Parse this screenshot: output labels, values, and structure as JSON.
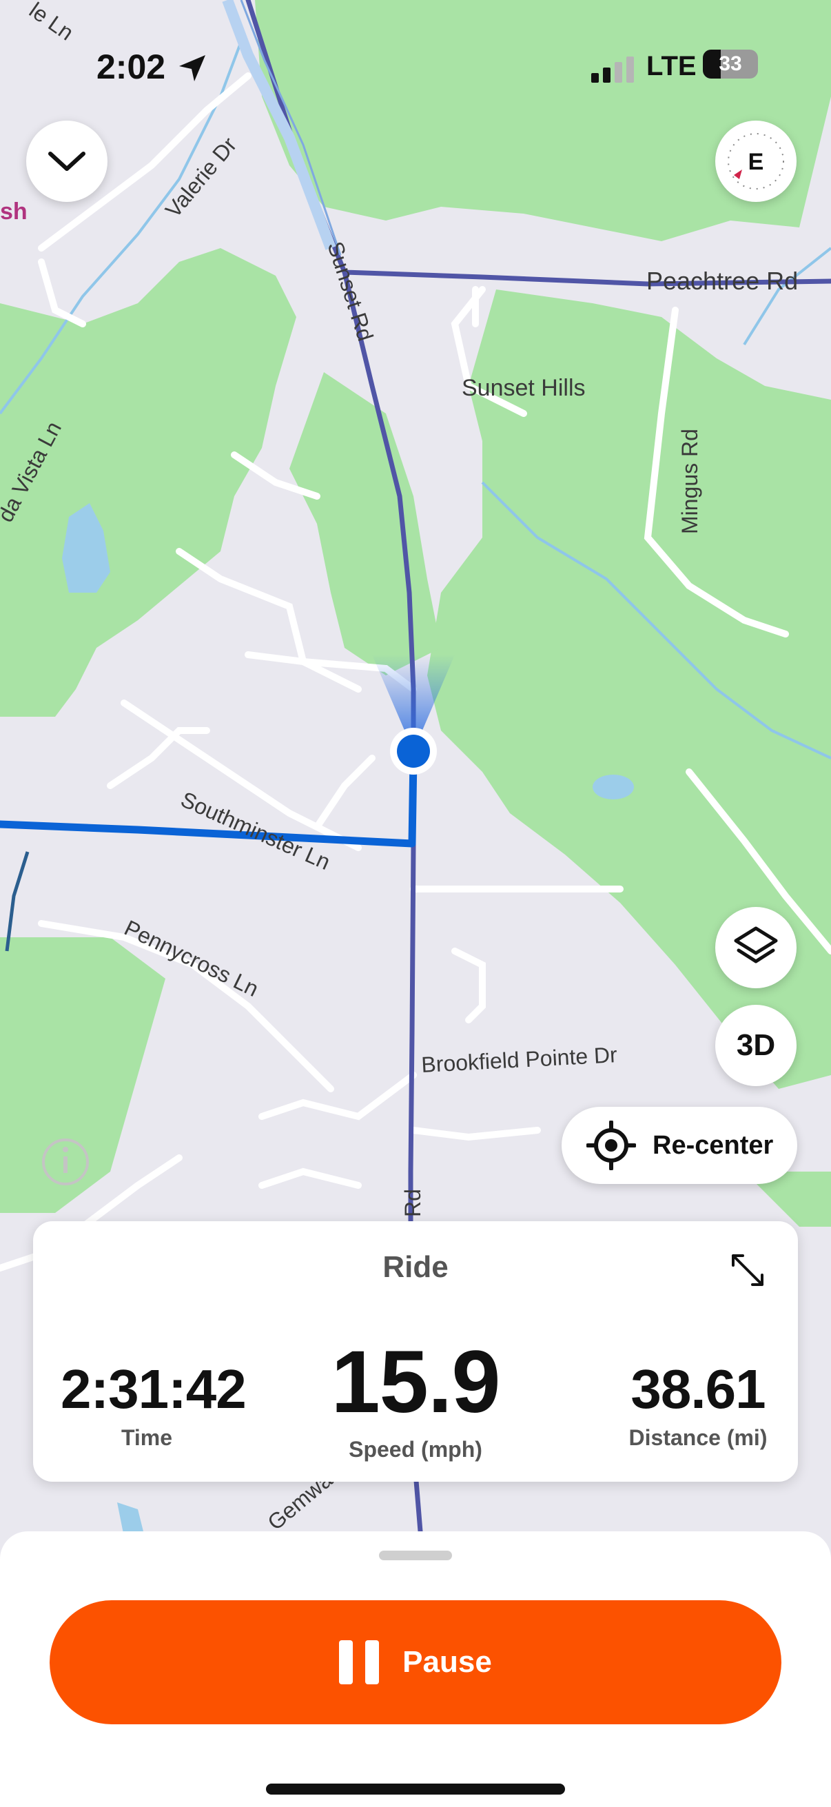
{
  "status_bar": {
    "time": "2:02",
    "network": "LTE",
    "battery": "33"
  },
  "map": {
    "street_labels": {
      "top_left": "le Ln",
      "valerie": "Valerie Dr",
      "partial_left": "sh",
      "sunset": "Sunset Rd",
      "peachtree": "Peachtree Rd",
      "sunset_hills": "Sunset Hills",
      "mingus": "Mingus Rd",
      "vista": "da Vista Ln",
      "southminster": "Southminster Ln",
      "pennycross": "Pennycross Ln",
      "brookfield": "Brookfield Pointe Dr",
      "rd": "Rd",
      "gemwa": "Gemwa"
    },
    "compass_letter": "E",
    "colors": {
      "park": "#a9e3a5",
      "base": "#e9e8ef",
      "route": "#0a63d6",
      "road_line": "#5055a6"
    }
  },
  "controls": {
    "three_d_label": "3D",
    "recenter_label": "Re-center"
  },
  "stats_card": {
    "title": "Ride",
    "time": {
      "value": "2:31:42",
      "label": "Time"
    },
    "speed": {
      "value": "15.9",
      "label": "Speed (mph)"
    },
    "distance": {
      "value": "38.61",
      "label": "Distance (mi)"
    }
  },
  "bottom_sheet": {
    "pause_label": "Pause",
    "accent_color": "#fc5200"
  }
}
